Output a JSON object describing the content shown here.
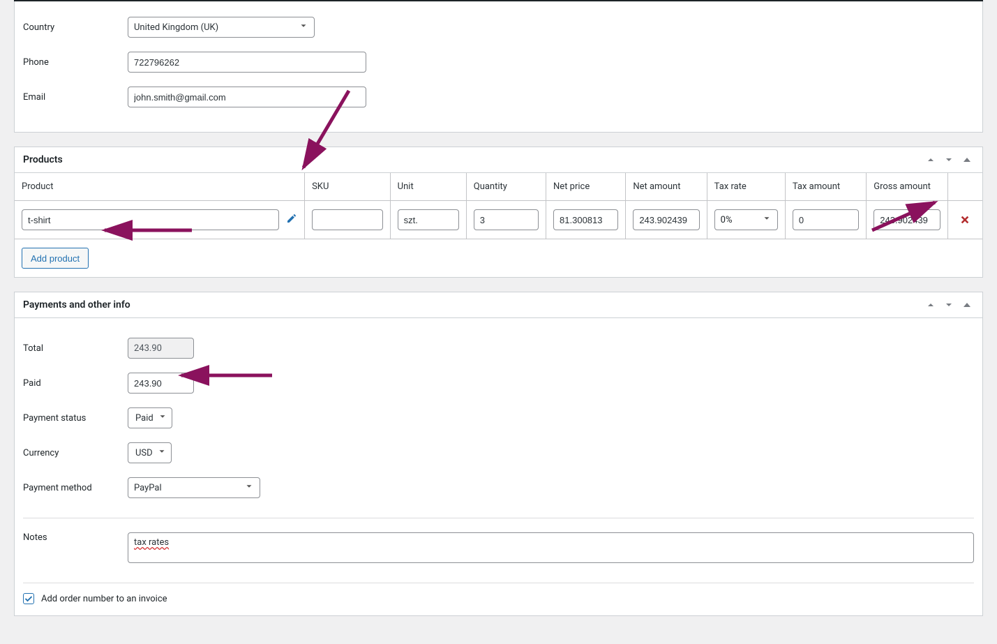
{
  "customer": {
    "country_label": "Country",
    "country_value": "United Kingdom (UK)",
    "phone_label": "Phone",
    "phone_value": "722796262",
    "email_label": "Email",
    "email_value": "john.smith@gmail.com"
  },
  "products": {
    "title": "Products",
    "headers": {
      "product": "Product",
      "sku": "SKU",
      "unit": "Unit",
      "quantity": "Quantity",
      "net_price": "Net price",
      "net_amount": "Net amount",
      "tax_rate": "Tax rate",
      "tax_amount": "Tax amount",
      "gross_amount": "Gross amount"
    },
    "rows": [
      {
        "product": "t-shirt",
        "sku": "",
        "unit": "szt.",
        "quantity": "3",
        "net_price": "81.300813",
        "net_amount": "243.902439",
        "tax_rate": "0%",
        "tax_amount": "0",
        "gross_amount": "243.902439"
      }
    ],
    "add_button": "Add product"
  },
  "payments": {
    "title": "Payments and other info",
    "total_label": "Total",
    "total_value": "243.90",
    "paid_label": "Paid",
    "paid_value": "243.90",
    "status_label": "Payment status",
    "status_value": "Paid",
    "currency_label": "Currency",
    "currency_value": "USD",
    "method_label": "Payment method",
    "method_value": "PayPal",
    "notes_label": "Notes",
    "notes_value": "tax rates",
    "checkbox_label": "Add order number to an invoice",
    "checkbox_checked": true
  }
}
